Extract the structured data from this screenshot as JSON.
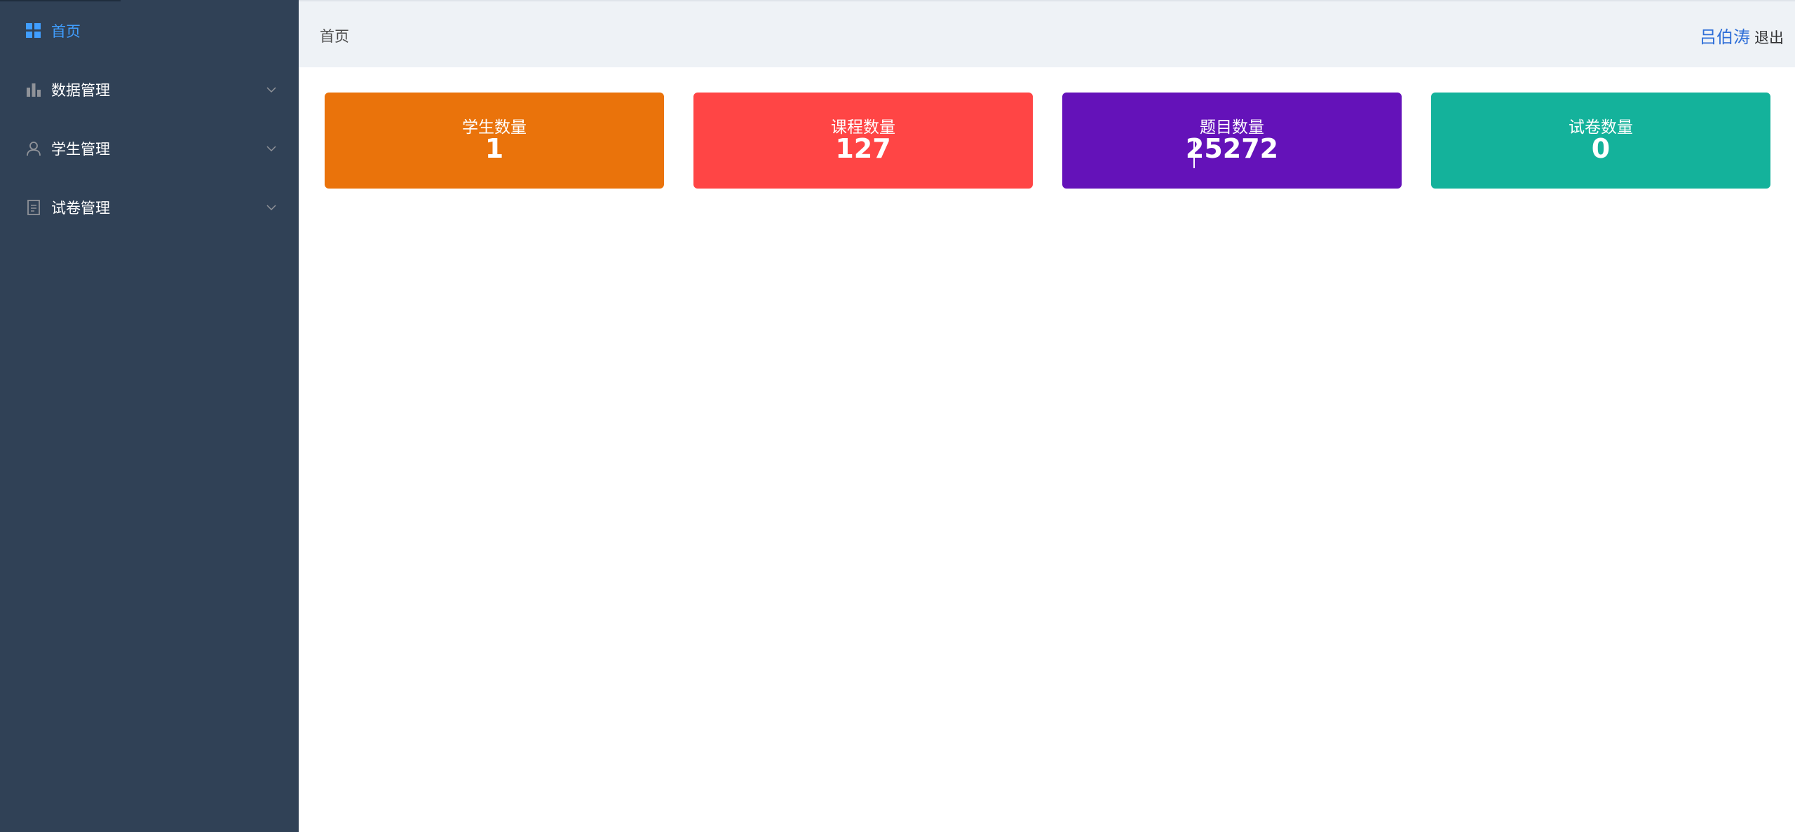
{
  "sidebar": {
    "items": [
      {
        "label": "首页",
        "icon": "grid-icon",
        "active": true
      },
      {
        "label": "数据管理",
        "icon": "bar-chart-icon",
        "expandable": true
      },
      {
        "label": "学生管理",
        "icon": "user-icon",
        "expandable": true
      },
      {
        "label": "试卷管理",
        "icon": "document-icon",
        "expandable": true
      }
    ]
  },
  "header": {
    "breadcrumb": "首页",
    "user_name": "吕伯涛",
    "logout_label": "退出"
  },
  "stats": [
    {
      "title": "学生数量",
      "value": "1",
      "color": "#ea730b"
    },
    {
      "title": "课程数量",
      "value": "127",
      "color": "#ff4545"
    },
    {
      "title": "题目数量",
      "value": "25272",
      "color": "#6412b9"
    },
    {
      "title": "试卷数量",
      "value": "0",
      "color": "#14b29b"
    }
  ],
  "colors": {
    "sidebar_bg": "#304156",
    "active_text": "#409eff",
    "topbar_bg": "#eef2f6",
    "user_name": "#2f6fd8"
  }
}
